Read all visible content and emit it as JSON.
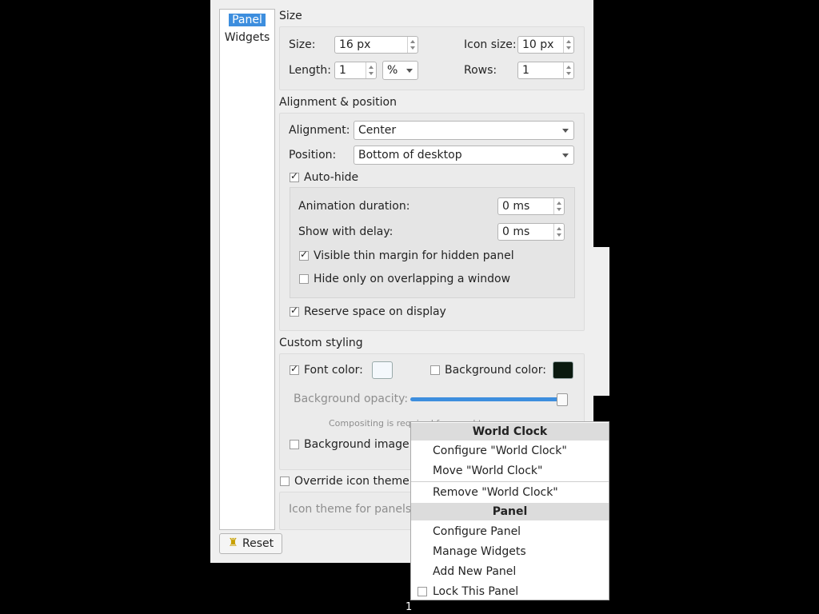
{
  "sidebar": {
    "items": [
      {
        "label": "Panel",
        "selected": true
      },
      {
        "label": "Widgets",
        "selected": false
      }
    ]
  },
  "size": {
    "title": "Size",
    "size_label": "Size:",
    "size_value": "16 px",
    "icon_size_label": "Icon size:",
    "icon_size_value": "10 px",
    "length_label": "Length:",
    "length_value": "1",
    "length_unit": "%",
    "rows_label": "Rows:",
    "rows_value": "1"
  },
  "alignment": {
    "title": "Alignment & position",
    "alignment_label": "Alignment:",
    "alignment_value": "Center",
    "position_label": "Position:",
    "position_value": "Bottom of desktop",
    "autohide_label": "Auto-hide",
    "autohide_checked": true,
    "anim_label": "Animation duration:",
    "anim_value": "0 ms",
    "delay_label": "Show with delay:",
    "delay_value": "0 ms",
    "thin_margin_label": "Visible thin margin for hidden panel",
    "thin_margin_checked": true,
    "hide_overlap_label": "Hide only on overlapping a window",
    "hide_overlap_checked": false,
    "reserve_label": "Reserve space on display",
    "reserve_checked": true
  },
  "styling": {
    "title": "Custom styling",
    "font_color_label": "Font color:",
    "font_color_checked": true,
    "font_color": "#f4f8fc",
    "bg_color_label": "Background color:",
    "bg_color_checked": false,
    "bg_color": "#0b1a10",
    "opacity_label": "Background opacity:",
    "opacity_value": 100,
    "compositing_note": "Compositing is required for panel t",
    "bg_image_label": "Background image:",
    "bg_image_checked": false
  },
  "icon_theme": {
    "override_label": "Override icon theme",
    "override_checked": false,
    "panels_label": "Icon theme for panels:"
  },
  "reset_label": "Reset",
  "context_menu": {
    "header1": "World Clock",
    "configure": "Configure \"World Clock\"",
    "move": "Move \"World Clock\"",
    "remove": "Remove \"World Clock\"",
    "header2": "Panel",
    "configure_panel": "Configure Panel",
    "manage_widgets": "Manage Widgets",
    "add_panel": "Add New Panel",
    "lock_panel": "Lock This Panel",
    "lock_checked": false
  },
  "desktop_indicator": "1"
}
